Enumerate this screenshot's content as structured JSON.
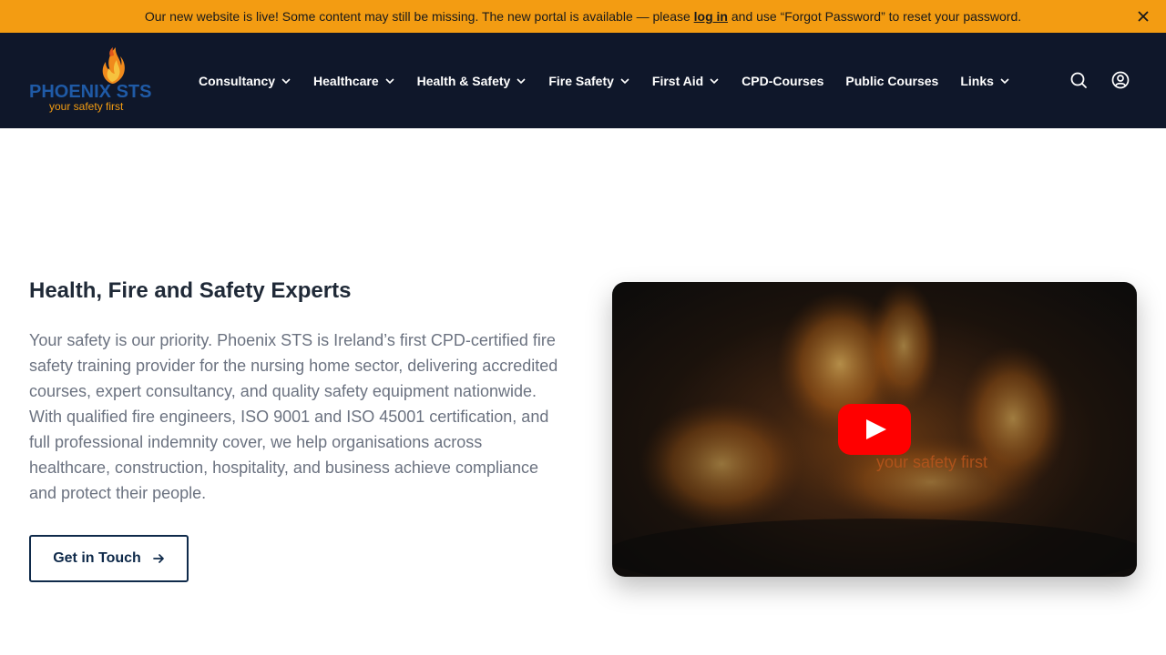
{
  "announcement": {
    "text_before": "Our new website is live! Some content may still be missing. The new portal is available — please ",
    "link": "log in",
    "text_after": " and use “Forgot Password” to reset your password.",
    "close_icon": "close-icon"
  },
  "header": {
    "logo": {
      "brand": "PHOENIX STS",
      "tagline": "your safety first"
    },
    "nav": [
      {
        "label": "Consultancy",
        "dropdown": true
      },
      {
        "label": "Healthcare",
        "dropdown": true
      },
      {
        "label": "Health & Safety",
        "dropdown": true
      },
      {
        "label": "Fire Safety",
        "dropdown": true
      },
      {
        "label": "First Aid",
        "dropdown": true
      },
      {
        "label": "CPD-Courses",
        "dropdown": false
      },
      {
        "label": "Public Courses",
        "dropdown": false
      },
      {
        "label": "Links",
        "dropdown": true
      }
    ],
    "icons": [
      "search-icon",
      "user-account-icon"
    ]
  },
  "hero": {
    "title": "Health, Fire and Safety Experts",
    "body": "Your safety is our priority. Phoenix STS is Ireland’s first CPD-certified fire safety training provider for the nursing home sector, delivering accredited courses, expert consultancy, and quality safety equipment nationwide. With qualified fire engineers, ISO 9001 and ISO 45001 certification, and full professional indemnity cover, we help organisations across healthcare, construction, hospitality, and business achieve compliance and protect their people.",
    "cta_label": "Get in Touch",
    "video": {
      "caption": "your safety first",
      "play_icon": "youtube-play-icon"
    }
  },
  "colors": {
    "banner": "#f39c12",
    "header_bg": "#0f172a",
    "brand_blue": "#1f5aa6",
    "cta_border": "#0f2a4a",
    "youtube_red": "#ff0000"
  }
}
